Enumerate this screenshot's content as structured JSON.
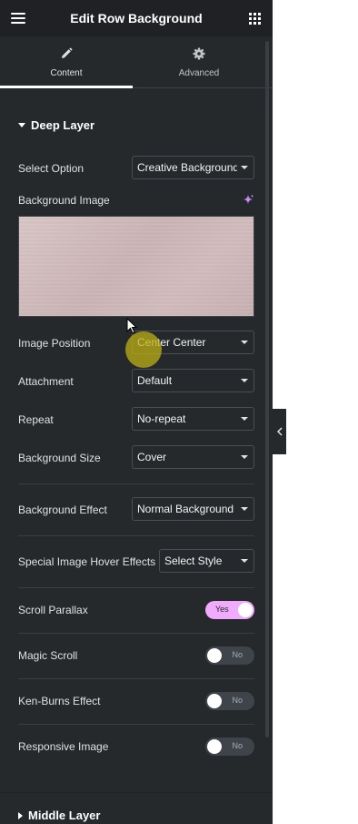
{
  "header": {
    "title": "Edit Row Background",
    "menu_icon": "hamburger-icon",
    "apps_icon": "grid-icon"
  },
  "tabs": [
    {
      "label": "Content",
      "icon": "pencil-icon",
      "active": true
    },
    {
      "label": "Advanced",
      "icon": "gear-icon",
      "active": false
    }
  ],
  "deep_layer": {
    "title": "Deep Layer",
    "select_option": {
      "label": "Select Option",
      "value": "Creative Background"
    },
    "background_image": {
      "label": "Background Image",
      "ai_icon": "sparkle-icon"
    },
    "image_position": {
      "label": "Image Position",
      "value": "Center Center"
    },
    "attachment": {
      "label": "Attachment",
      "value": "Default"
    },
    "repeat": {
      "label": "Repeat",
      "value": "No-repeat"
    },
    "background_size": {
      "label": "Background Size",
      "value": "Cover"
    },
    "background_effect": {
      "label": "Background Effect",
      "value": "Normal Background"
    },
    "hover_effects": {
      "label": "Special Image Hover Effects",
      "value": "Select Style"
    },
    "scroll_parallax": {
      "label": "Scroll Parallax",
      "state": "Yes",
      "on": true
    },
    "magic_scroll": {
      "label": "Magic Scroll",
      "state": "No",
      "on": false
    },
    "ken_burns": {
      "label": "Ken-Burns Effect",
      "state": "No",
      "on": false
    },
    "responsive_image": {
      "label": "Responsive Image",
      "state": "No",
      "on": false
    }
  },
  "middle_layer": {
    "title": "Middle Layer"
  },
  "colors": {
    "panel": "#26292c",
    "header": "#1f2124",
    "toggle_on": "#f0abfc",
    "accent_ai": "#c98bf5"
  }
}
